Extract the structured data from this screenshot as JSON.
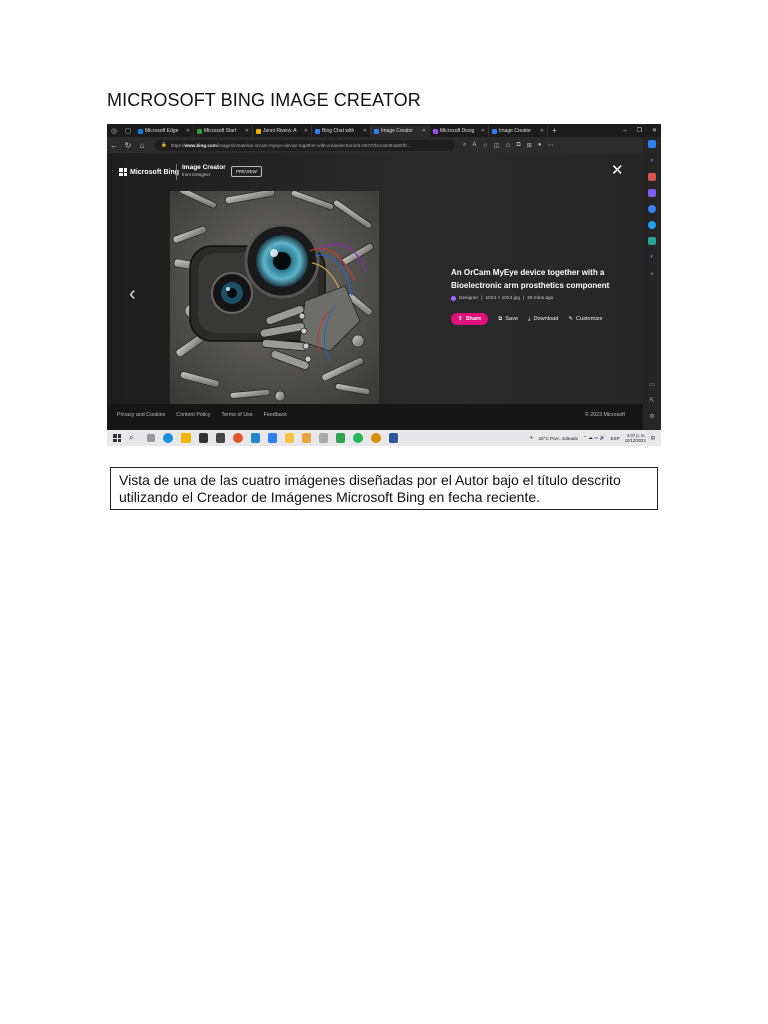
{
  "document": {
    "title": "MICROSOFT BING IMAGE CREATOR",
    "caption": "Vista de una de las cuatro imágenes diseñadas por el Autor bajo el título descrito utilizando el Creador de Imágenes Microsoft Bing en fecha reciente."
  },
  "browser": {
    "tabs": [
      {
        "label": "Microsoft Edge",
        "color": "#0f7bd8"
      },
      {
        "label": "Microsoft Start",
        "color": "#2d9b3a"
      },
      {
        "label": "Jenni Rivera: A",
        "color": "#f2b300"
      },
      {
        "label": "Bing Chat with",
        "color": "#2f7ff0"
      },
      {
        "label": "Image Creator",
        "color": "#2f7ff0"
      },
      {
        "label": "Microsoft Desig",
        "color": "#9a4cf0"
      },
      {
        "label": "Image Creator",
        "color": "#2f7ff0"
      }
    ],
    "active_tab": 4,
    "url_prefix": "https://",
    "url_domain": "www.bing.com",
    "url_rest": "/images/create/an-orcam-myeye-device-together-with-a-bioelectronic/1-65707bcca0494a05f0..."
  },
  "page": {
    "brand": "Microsoft Bing",
    "app_title": "Image Creator",
    "app_subtitle": "from Designer",
    "preview_badge": "PREVIEW",
    "image_title": "An OrCam MyEye device together with a Bioelectronic arm prosthetics component",
    "meta_source": "Designer",
    "meta_size": "1024 × 1024 jpg",
    "meta_time": "26 mins ago",
    "actions": {
      "share": "Share",
      "save": "Save",
      "download": "Download",
      "customize": "Customize"
    },
    "accent_color": "#e0107a"
  },
  "footer": {
    "links": [
      "Privacy and Cookies",
      "Content Policy",
      "Terms of Use",
      "Feedback"
    ],
    "copyright": "© 2023 Microsoft"
  },
  "taskbar": {
    "weather": "29°C  Parc. soleado",
    "language": "ESP",
    "time": "4:07 p. m.",
    "date": "10/12/2023"
  }
}
